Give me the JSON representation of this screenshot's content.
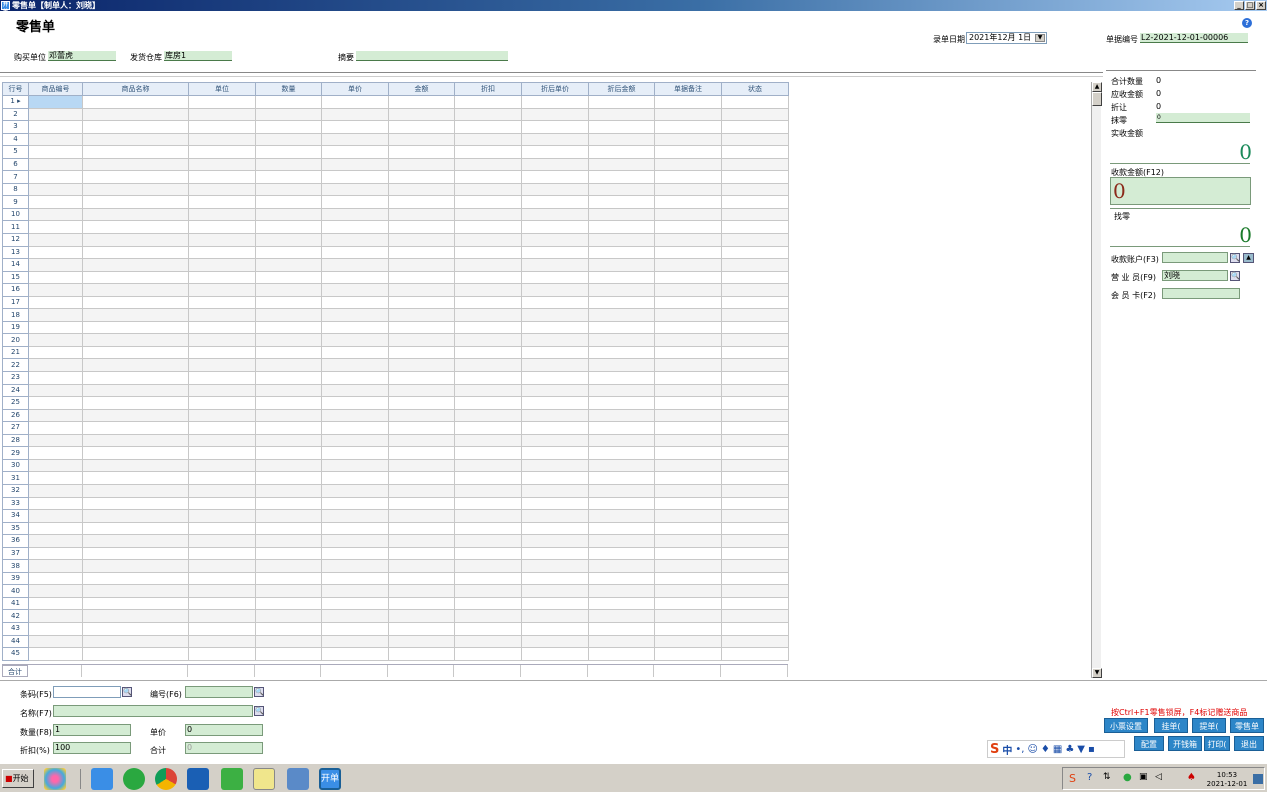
{
  "window": {
    "title": "零售单【制单人：刘晓】",
    "icon_text": "开单"
  },
  "page_title": "零售单",
  "header": {
    "buyer_label": "购买单位",
    "buyer_value": "邓蕾虎",
    "warehouse_label": "发货仓库",
    "warehouse_value": "库房1",
    "summary_label": "摘要",
    "summary_value": "",
    "date_label": "录单日期",
    "date_value": "2021年12月 1日",
    "docno_label": "单据编号",
    "docno_value": "L2-2021-12-01-00006"
  },
  "grid": {
    "columns": [
      "行号",
      "商品编号",
      "商品名称",
      "单位",
      "数量",
      "单价",
      "金额",
      "折扣",
      "折后单价",
      "折后金额",
      "单据备注",
      "状态"
    ],
    "row_count": 45,
    "total_label": "合计"
  },
  "right_panel": {
    "total_qty_label": "合计数量",
    "total_qty": "0",
    "receivable_label": "应收金额",
    "receivable": "0",
    "discount_label": "折让",
    "discount": "0",
    "rounding_label": "抹零",
    "rounding": "0",
    "actual_label": "实收金额",
    "actual": "0",
    "received_label": "收款金额(F12)",
    "received": "0",
    "change_label": "找零",
    "change": "0",
    "account_label": "收款账户(F3)",
    "account": "",
    "salesman_label": "营 业 员(F9)",
    "salesman": "刘晓",
    "member_label": "会 员 卡(F2)",
    "member": ""
  },
  "bottom": {
    "barcode_label": "条码(F5)",
    "barcode": "",
    "code_label": "编号(F6)",
    "code": "",
    "name_label": "名称(F7)",
    "name": "",
    "qty_label": "数量(F8)",
    "qty": "1",
    "price_label": "单价",
    "price": "0",
    "discount_label": "折扣(%)",
    "discount": "100",
    "total_label": "合计",
    "total": "0"
  },
  "hint": "按Ctrl+F1零售锁屏，F4标记赠送商品",
  "buttons": [
    "小票设置",
    "挂单(",
    "提单(",
    "零售单",
    "配置",
    "开钱箱",
    "打印(",
    "退出"
  ],
  "taskbar": {
    "start": "开始",
    "time": "10:53",
    "date": "2021-12-01"
  },
  "colors": {
    "field_bg": "#d4ecd4",
    "button_bg": "#2d86c8",
    "title_gradient_start": "#0a246a",
    "accent_green": "#1a8a3a",
    "accent_red": "#8b2a1a"
  }
}
